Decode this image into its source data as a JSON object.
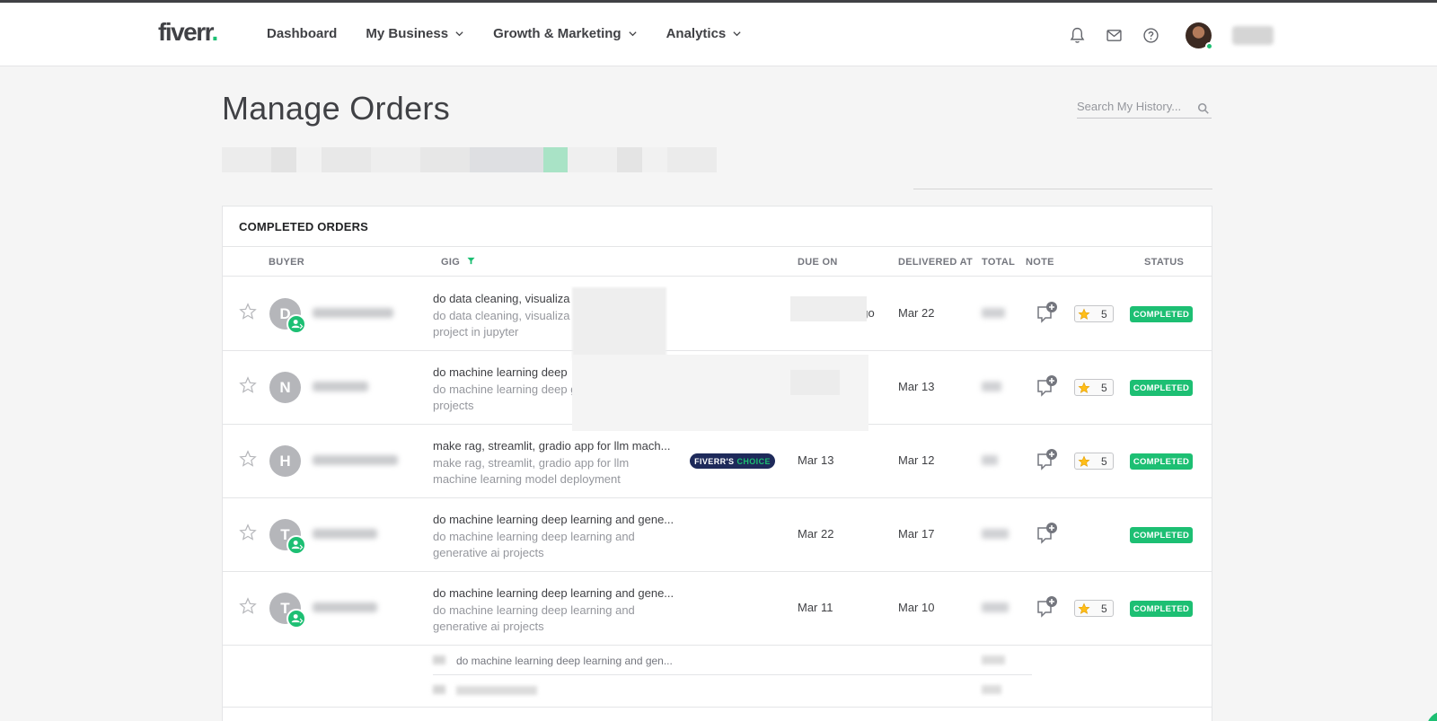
{
  "header": {
    "logo": "fiverr",
    "logo_dot": ".",
    "nav": [
      {
        "label": "Dashboard",
        "has_dropdown": false
      },
      {
        "label": "My Business",
        "has_dropdown": true
      },
      {
        "label": "Growth & Marketing",
        "has_dropdown": true
      },
      {
        "label": "Analytics",
        "has_dropdown": true
      }
    ],
    "icons": [
      "bell-icon",
      "envelope-icon",
      "help-icon"
    ]
  },
  "page": {
    "title": "Manage Orders",
    "search_placeholder": "Search My History..."
  },
  "orders": {
    "section_title": "COMPLETED ORDERS",
    "columns": {
      "buyer": "BUYER",
      "gig": "GIG",
      "due_on": "DUE ON",
      "delivered_at": "DELIVERED AT",
      "total": "TOTAL",
      "note": "NOTE",
      "status": "STATUS"
    },
    "rows": [
      {
        "initial": "D",
        "repeat_buyer": true,
        "gig_title": "do data cleaning, visualiza",
        "gig_desc": "do data cleaning, visualiza learning project in jupyter",
        "due_on": "ago",
        "delivered_at": "Mar 22",
        "rating": "5",
        "status": "COMPLETED"
      },
      {
        "initial": "N",
        "repeat_buyer": false,
        "gig_title": "do machine learning deep",
        "gig_desc": "do machine learning deep generative ai projects",
        "due_on": "",
        "delivered_at": "Mar 13",
        "rating": "5",
        "status": "COMPLETED"
      },
      {
        "initial": "H",
        "repeat_buyer": false,
        "gig_title": "make rag, streamlit, gradio app for llm mach...",
        "gig_desc": "make rag, streamlit, gradio app for llm machine learning model deployment",
        "badge": {
          "part1": "FIVERR'S",
          "part2": "CHOICE"
        },
        "due_on": "Mar 13",
        "delivered_at": "Mar 12",
        "rating": "5",
        "status": "COMPLETED"
      },
      {
        "initial": "T",
        "repeat_buyer": true,
        "gig_title": "do machine learning deep learning and gene...",
        "gig_desc": "do machine learning deep learning and generative ai projects",
        "due_on": "Mar 22",
        "delivered_at": "Mar 17",
        "rating": "",
        "status": "COMPLETED"
      },
      {
        "initial": "T",
        "repeat_buyer": true,
        "gig_title": "do machine learning deep learning and gene...",
        "gig_desc": "do machine learning deep learning and generative ai projects",
        "due_on": "Mar 11",
        "delivered_at": "Mar 10",
        "rating": "5",
        "status": "COMPLETED"
      }
    ],
    "sub_rows": [
      {
        "text": "do machine learning deep learning and gen..."
      },
      {
        "text": ""
      }
    ]
  },
  "colors": {
    "brand_green": "#1dbf73",
    "text_dark": "#404145",
    "badge_navy": "#1e2a5a",
    "star_yellow": "#ffbe18"
  }
}
